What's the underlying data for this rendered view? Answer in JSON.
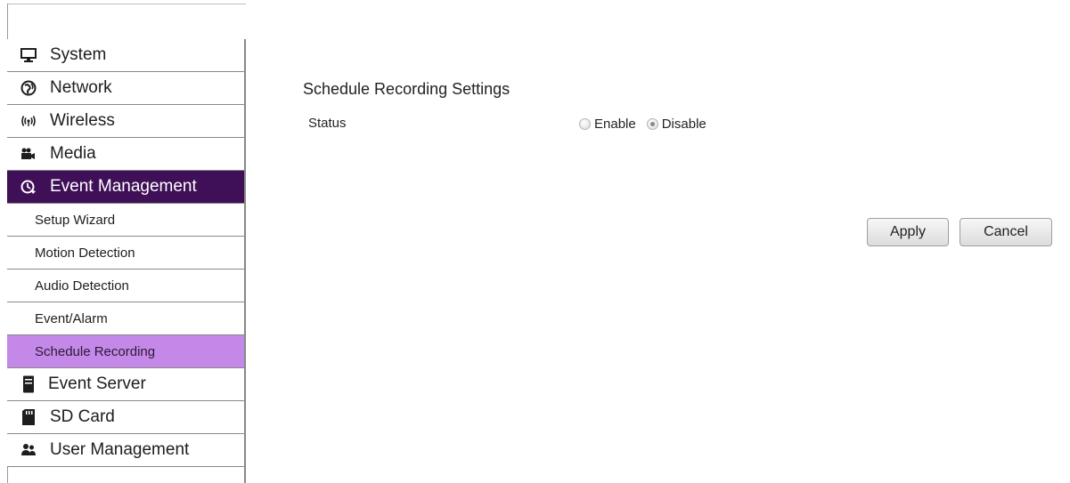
{
  "sidebar": {
    "items": [
      {
        "label": "System",
        "icon": "monitor-icon"
      },
      {
        "label": "Network",
        "icon": "globe-icon"
      },
      {
        "label": "Wireless",
        "icon": "wireless-icon"
      },
      {
        "label": "Media",
        "icon": "camera-icon"
      },
      {
        "label": "Event Management",
        "icon": "event-management-icon"
      },
      {
        "label": "Event Server",
        "icon": "server-icon"
      },
      {
        "label": "SD Card",
        "icon": "sd-card-icon"
      },
      {
        "label": "User Management",
        "icon": "users-icon"
      }
    ],
    "subitems": [
      {
        "label": "Setup Wizard"
      },
      {
        "label": "Motion Detection"
      },
      {
        "label": "Audio Detection"
      },
      {
        "label": "Event/Alarm"
      },
      {
        "label": "Schedule Recording"
      }
    ],
    "active_parent": "Event Management",
    "active_subitem": "Schedule Recording"
  },
  "main": {
    "title": "Schedule Recording Settings",
    "status_label": "Status",
    "options": [
      {
        "label": "Enable",
        "checked": false
      },
      {
        "label": "Disable",
        "checked": true
      }
    ],
    "apply_label": "Apply",
    "cancel_label": "Cancel"
  },
  "colors": {
    "active_parent_bg": "#3f0f57",
    "active_subitem_bg": "#c488e8"
  }
}
